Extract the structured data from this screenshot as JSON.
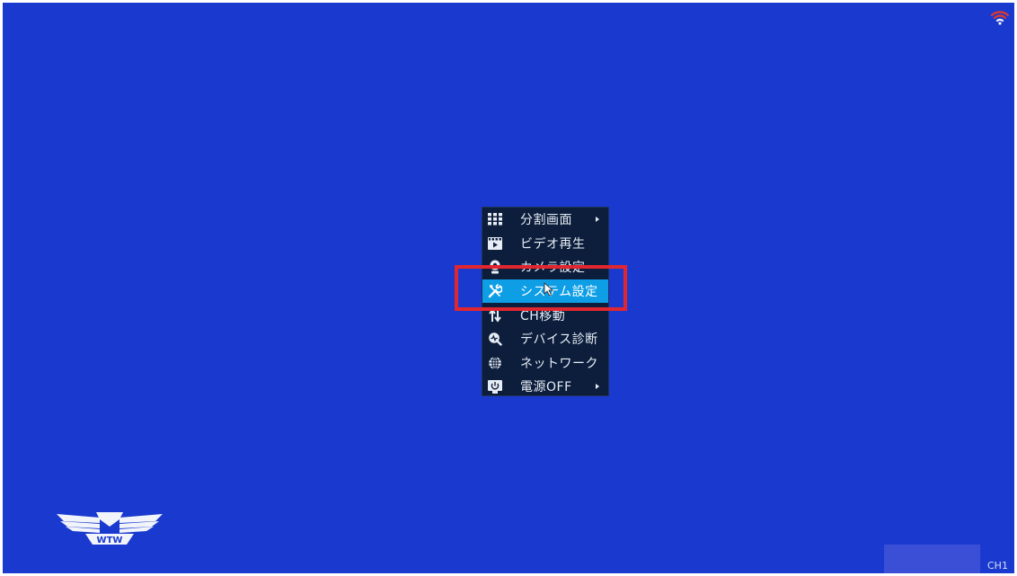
{
  "colors": {
    "background": "#1a3acf",
    "menu_bg": "#0c1e3c",
    "menu_selected": "#0e9ee6",
    "highlight_box": "#e2262f",
    "wifi_signal": "#e23a2a"
  },
  "context_menu": {
    "items": [
      {
        "label": "分割画面",
        "icon": "grid-icon",
        "has_submenu": true
      },
      {
        "label": "ビデオ再生",
        "icon": "video-playback-icon",
        "has_submenu": false
      },
      {
        "label": "カメラ設定",
        "icon": "camera-icon",
        "has_submenu": false
      },
      {
        "label": "システム設定",
        "icon": "tools-icon",
        "has_submenu": false,
        "selected": true
      },
      {
        "label": "CH移動",
        "icon": "channel-move-icon",
        "has_submenu": false
      },
      {
        "label": "デバイス診断",
        "icon": "diagnostics-icon",
        "has_submenu": false
      },
      {
        "label": "ネットワーク",
        "icon": "globe-icon",
        "has_submenu": false
      },
      {
        "label": "電源OFF",
        "icon": "power-screen-icon",
        "has_submenu": true
      }
    ]
  },
  "status": {
    "channel_label": "CH1",
    "wifi_icon": "wifi-icon"
  },
  "branding": {
    "logo_text": "WTW",
    "logo_icon": "winged-logo-icon"
  }
}
